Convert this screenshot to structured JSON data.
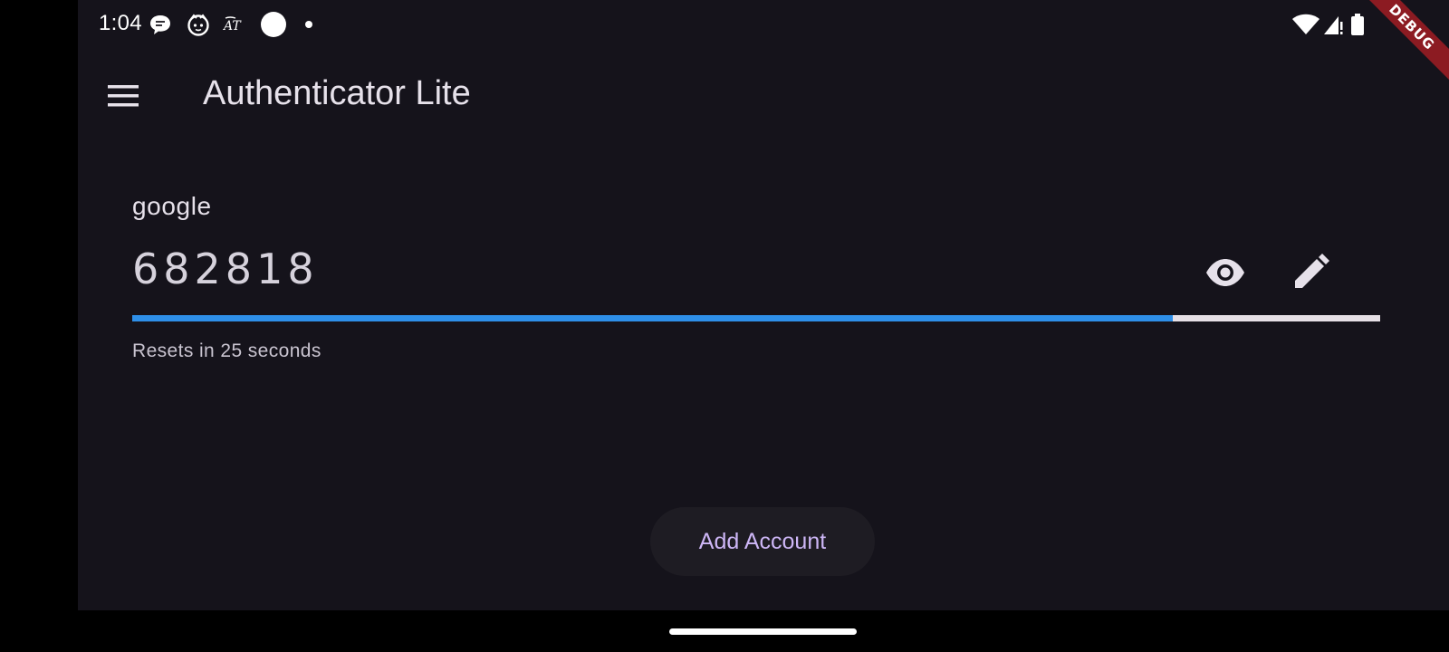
{
  "status_bar": {
    "time": "1:04",
    "left_icons": [
      "chat-bubble-icon",
      "cat-face-icon",
      "translate-icon",
      "white-circle-icon",
      "dot-icon"
    ],
    "right_icons": [
      "wifi-icon",
      "signal-icon",
      "battery-icon"
    ]
  },
  "debug_banner": "DEBUG",
  "app_bar": {
    "menu_icon": "menu-icon",
    "title": "Authenticator Lite"
  },
  "accounts": [
    {
      "name": "google",
      "code": "682818",
      "progress": 0.834,
      "reset_text": "Resets in 25 seconds",
      "actions": [
        "eye-icon",
        "edit-icon"
      ]
    }
  ],
  "add_button": {
    "label": "Add Account"
  },
  "colors": {
    "background": "#15131b",
    "progress_fill": "#2e8fe8",
    "progress_track": "#e6e0e6",
    "button_text": "#cdb6f6",
    "debug_banner": "#8c1b22"
  }
}
